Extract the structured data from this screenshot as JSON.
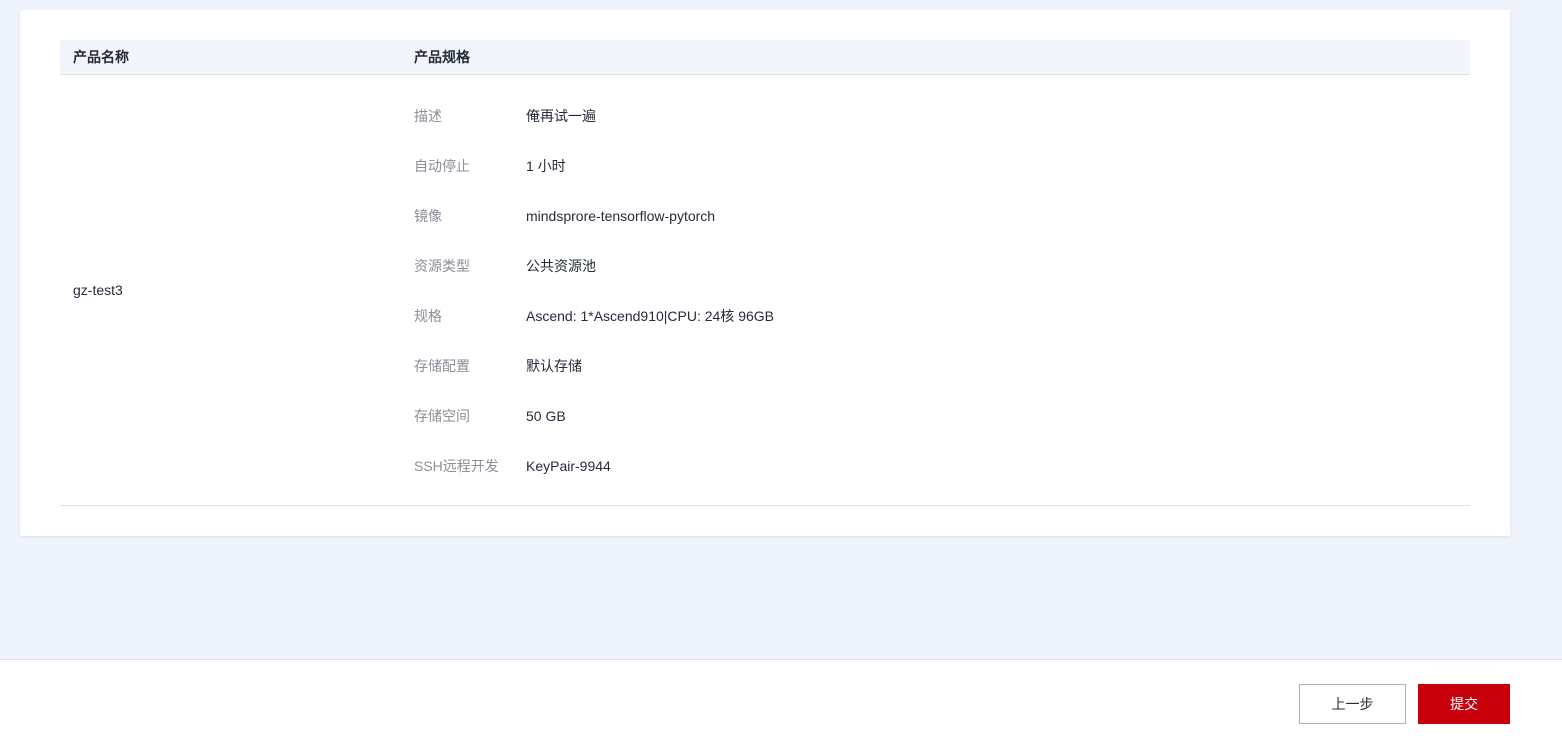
{
  "table": {
    "headers": {
      "name": "产品名称",
      "spec": "产品规格"
    },
    "product_name": "gz-test3",
    "specs": [
      {
        "label": "描述",
        "value": "俺再试一遍"
      },
      {
        "label": "自动停止",
        "value": "1 小时"
      },
      {
        "label": "镜像",
        "value": "mindsprore-tensorflow-pytorch"
      },
      {
        "label": "资源类型",
        "value": "公共资源池"
      },
      {
        "label": "规格",
        "value": "Ascend: 1*Ascend910|CPU: 24核 96GB"
      },
      {
        "label": "存储配置",
        "value": "默认存储"
      },
      {
        "label": "存储空间",
        "value": "50 GB"
      },
      {
        "label": "SSH远程开发",
        "value": "KeyPair-9944"
      }
    ]
  },
  "footer": {
    "prev_label": "上一步",
    "submit_label": "提交"
  },
  "colors": {
    "background": "#eff3fb",
    "header_bg": "#f2f5fc",
    "primary": "#c7000b"
  }
}
